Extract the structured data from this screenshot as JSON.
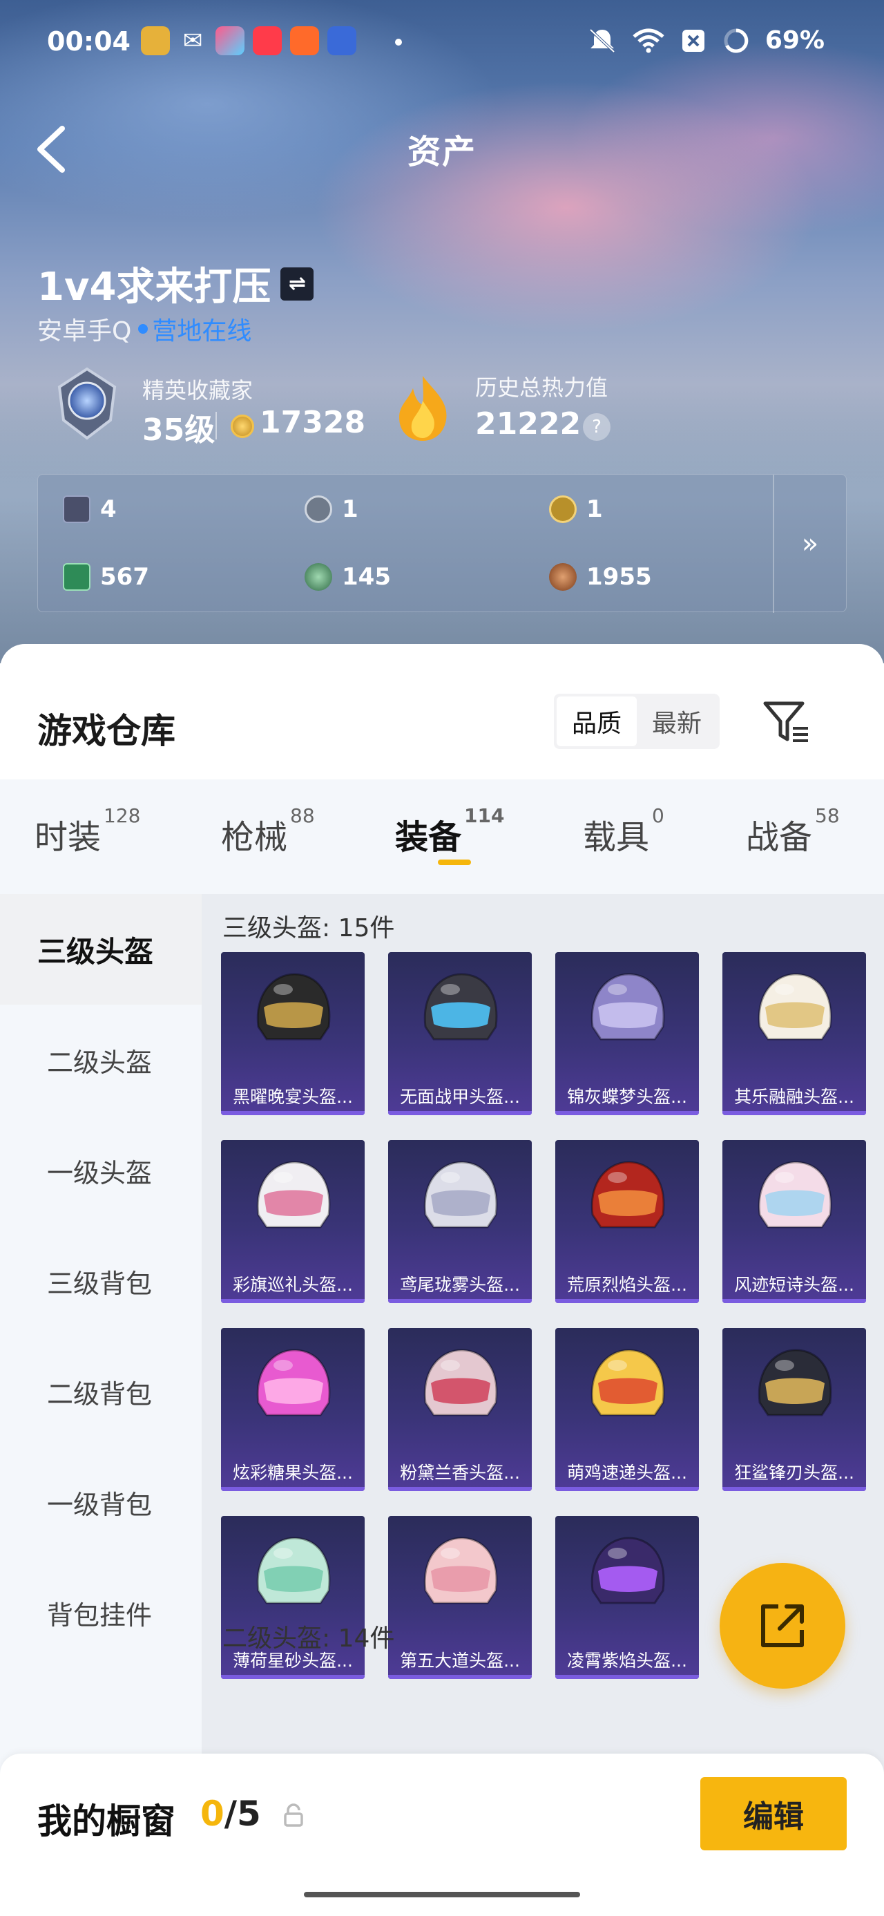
{
  "status_bar": {
    "time": "00:04",
    "battery": "69%"
  },
  "nav": {
    "title": "资产"
  },
  "profile": {
    "name": "1v4求来打压",
    "platform": "安卓手Q",
    "online": "营地在线",
    "rank_label": "精英收藏家",
    "rank_level": "35级",
    "coins": "17328",
    "heat_label": "历史总热力值",
    "heat_value": "21222",
    "help": "?"
  },
  "stats": {
    "items": [
      {
        "value": "4",
        "icon": "card-icon",
        "color": "#4a4f6a"
      },
      {
        "value": "1",
        "icon": "silver-token-icon",
        "color": "#6f7a8a"
      },
      {
        "value": "1",
        "icon": "gold-token-icon",
        "color": "#b8902a"
      },
      {
        "value": "567",
        "icon": "ticket-icon",
        "color": "#2e8b57"
      },
      {
        "value": "145",
        "icon": "green-orb-icon",
        "color": "#3f7f55"
      },
      {
        "value": "1955",
        "icon": "bronze-orb-icon",
        "color": "#a0622d"
      }
    ],
    "more": "»"
  },
  "warehouse": {
    "title": "游戏仓库",
    "sort_options": [
      "品质",
      "最新"
    ],
    "tabs": [
      {
        "label": "时装",
        "count": "128"
      },
      {
        "label": "枪械",
        "count": "88"
      },
      {
        "label": "装备",
        "count": "114"
      },
      {
        "label": "载具",
        "count": "0"
      },
      {
        "label": "战备",
        "count": "58"
      }
    ],
    "categories": [
      "三级头盔",
      "二级头盔",
      "一级头盔",
      "三级背包",
      "二级背包",
      "一级背包",
      "背包挂件"
    ],
    "section_title": "三级头盔: 15件",
    "next_section_title": "二级头盔: 14件",
    "items": [
      {
        "name": "黑曜晚宴头盔...",
        "color": "#2a2a2a",
        "accent": "#c8a24a"
      },
      {
        "name": "无面战甲头盔...",
        "color": "#3a3a44",
        "accent": "#4fc3f7"
      },
      {
        "name": "锦灰蝶梦头盔...",
        "color": "#8e85c9",
        "accent": "#c9c2f0"
      },
      {
        "name": "其乐融融头盔...",
        "color": "#f5efe4",
        "accent": "#e0c27a"
      },
      {
        "name": "彩旗巡礼头盔...",
        "color": "#f0eef2",
        "accent": "#e07aa0"
      },
      {
        "name": "鸢尾珑雾头盔...",
        "color": "#dcdde8",
        "accent": "#a8acc8"
      },
      {
        "name": "荒原烈焰头盔...",
        "color": "#b3261e",
        "accent": "#f08a3c"
      },
      {
        "name": "风迹短诗头盔...",
        "color": "#f4dce8",
        "accent": "#a6d4f0"
      },
      {
        "name": "炫彩糖果头盔...",
        "color": "#e85ad0",
        "accent": "#ffb0e8"
      },
      {
        "name": "粉黛兰香头盔...",
        "color": "#e4c8d0",
        "accent": "#d04860"
      },
      {
        "name": "萌鸡速递头盔...",
        "color": "#f5c84a",
        "accent": "#e05030"
      },
      {
        "name": "狂鲨锋刃头盔...",
        "color": "#2a2c38",
        "accent": "#d9b25a"
      },
      {
        "name": "薄荷星砂头盔...",
        "color": "#bfe8d8",
        "accent": "#7acdb0"
      },
      {
        "name": "第五大道头盔...",
        "color": "#f3c8cc",
        "accent": "#e898a8"
      },
      {
        "name": "凌霄紫焰头盔...",
        "color": "#3a2a6a",
        "accent": "#b060ff"
      }
    ]
  },
  "bottom_bar": {
    "title": "我的橱窗",
    "current": "0",
    "total": "/5",
    "edit": "编辑"
  }
}
